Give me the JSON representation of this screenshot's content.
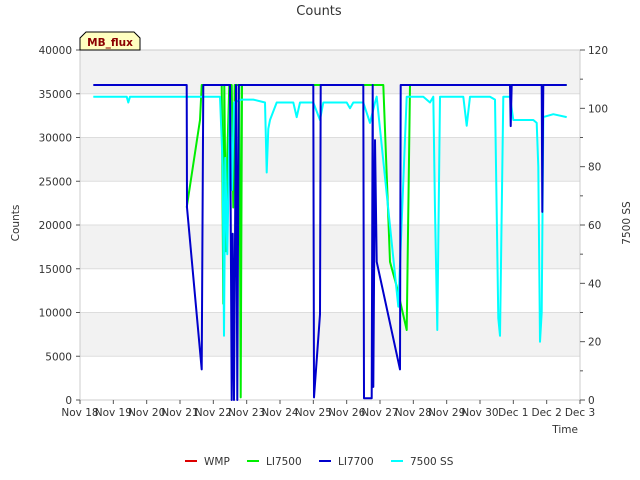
{
  "chart_data": {
    "type": "line",
    "title": "Counts",
    "xlabel": "Time",
    "ylabel": "Counts",
    "y2label": "7500 SS",
    "tag": "MB_flux",
    "x_ticks": [
      "Nov 18",
      "Nov 19",
      "Nov 20",
      "Nov 21",
      "Nov 22",
      "Nov 23",
      "Nov 24",
      "Nov 25",
      "Nov 26",
      "Nov 27",
      "Nov 28",
      "Nov 29",
      "Nov 30",
      "Dec 1",
      "Dec 2",
      "Dec 3"
    ],
    "y_ticks": [
      "0",
      "5000",
      "10000",
      "15000",
      "20000",
      "25000",
      "30000",
      "35000",
      "40000"
    ],
    "y2_ticks": [
      "0",
      "20",
      "40",
      "60",
      "80",
      "100",
      "120"
    ],
    "ylim": [
      0,
      40000
    ],
    "y2lim": [
      0,
      120
    ],
    "xlim_days": [
      0,
      15
    ],
    "grid": true,
    "legend_position": "bottom",
    "series": [
      {
        "name": "WMP",
        "color": "#dd0000",
        "axis": "left",
        "points": []
      },
      {
        "name": "LI7500",
        "color": "#00ee00",
        "axis": "left",
        "points": [
          [
            3.2,
            22000
          ],
          [
            3.6,
            32000
          ],
          [
            3.65,
            36000
          ],
          [
            4.1,
            36000
          ],
          [
            4.25,
            36000
          ],
          [
            4.3,
            11000
          ],
          [
            4.33,
            36000
          ],
          [
            4.38,
            17000
          ],
          [
            4.42,
            28000
          ],
          [
            4.48,
            36000
          ],
          [
            4.55,
            36000
          ],
          [
            4.6,
            22000
          ],
          [
            4.64,
            36000
          ],
          [
            4.7,
            36000
          ],
          [
            4.78,
            36000
          ],
          [
            4.82,
            300
          ],
          [
            4.86,
            36000
          ],
          [
            4.95,
            36000
          ],
          [
            9.1,
            36000
          ],
          [
            9.3,
            15800
          ],
          [
            9.5,
            13000
          ],
          [
            9.8,
            8000
          ],
          [
            9.9,
            36000
          ],
          [
            14.6,
            36000
          ]
        ]
      },
      {
        "name": "LI7700",
        "color": "#0000cc",
        "axis": "left",
        "points": [
          [
            0.4,
            36000
          ],
          [
            3.2,
            36000
          ],
          [
            3.21,
            22000
          ],
          [
            3.65,
            3500
          ],
          [
            3.7,
            36000
          ],
          [
            4.5,
            36000
          ],
          [
            4.55,
            0
          ],
          [
            4.58,
            19000
          ],
          [
            4.62,
            0
          ],
          [
            4.68,
            36000
          ],
          [
            4.72,
            0
          ],
          [
            4.76,
            36000
          ],
          [
            7.0,
            36000
          ],
          [
            7.02,
            300
          ],
          [
            7.2,
            9800
          ],
          [
            7.22,
            36000
          ],
          [
            8.5,
            36000
          ],
          [
            8.52,
            200
          ],
          [
            8.75,
            200
          ],
          [
            8.78,
            36000
          ],
          [
            8.8,
            1500
          ],
          [
            8.85,
            29700
          ],
          [
            8.9,
            15800
          ],
          [
            9.6,
            3500
          ],
          [
            9.62,
            36000
          ],
          [
            12.9,
            36000
          ],
          [
            12.92,
            31300
          ],
          [
            12.95,
            36000
          ],
          [
            13.85,
            36000
          ],
          [
            13.87,
            21500
          ],
          [
            13.9,
            36000
          ],
          [
            14.6,
            36000
          ]
        ]
      },
      {
        "name": "7500 SS",
        "color": "#00ffff",
        "axis": "right",
        "points": [
          [
            0.4,
            104
          ],
          [
            1.4,
            104
          ],
          [
            1.45,
            102
          ],
          [
            1.5,
            104
          ],
          [
            3.2,
            104
          ],
          [
            3.8,
            104
          ],
          [
            4.2,
            104
          ],
          [
            4.28,
            80
          ],
          [
            4.32,
            22
          ],
          [
            4.36,
            83
          ],
          [
            4.42,
            50
          ],
          [
            4.5,
            104
          ],
          [
            4.56,
            72
          ],
          [
            4.62,
            102
          ],
          [
            4.85,
            103
          ],
          [
            5.2,
            103
          ],
          [
            5.55,
            102
          ],
          [
            5.6,
            78
          ],
          [
            5.65,
            93
          ],
          [
            5.7,
            96
          ],
          [
            5.9,
            102
          ],
          [
            6.4,
            102
          ],
          [
            6.5,
            97
          ],
          [
            6.6,
            102
          ],
          [
            7.0,
            102
          ],
          [
            7.2,
            96
          ],
          [
            7.3,
            102
          ],
          [
            8.0,
            102
          ],
          [
            8.1,
            100
          ],
          [
            8.2,
            102
          ],
          [
            8.5,
            102
          ],
          [
            8.7,
            95
          ],
          [
            8.85,
            102
          ],
          [
            8.9,
            104
          ],
          [
            9.55,
            32
          ],
          [
            9.8,
            104
          ],
          [
            10.3,
            104
          ],
          [
            10.5,
            102
          ],
          [
            10.6,
            104
          ],
          [
            10.65,
            65
          ],
          [
            10.72,
            24
          ],
          [
            10.8,
            104
          ],
          [
            11.5,
            104
          ],
          [
            11.6,
            94
          ],
          [
            11.7,
            104
          ],
          [
            12.3,
            104
          ],
          [
            12.45,
            103
          ],
          [
            12.55,
            28
          ],
          [
            12.6,
            22
          ],
          [
            12.7,
            104
          ],
          [
            12.9,
            104
          ],
          [
            13.0,
            96
          ],
          [
            13.6,
            96
          ],
          [
            13.7,
            95
          ],
          [
            13.75,
            80
          ],
          [
            13.8,
            20
          ],
          [
            13.85,
            30
          ],
          [
            13.9,
            97
          ],
          [
            14.2,
            98
          ],
          [
            14.6,
            97
          ]
        ]
      }
    ]
  }
}
